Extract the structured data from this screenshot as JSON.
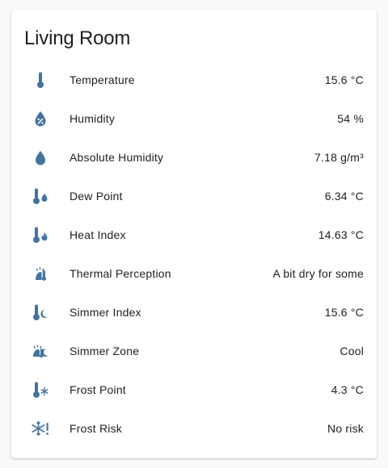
{
  "card": {
    "title": "Living Room",
    "icon_color": "#44739e",
    "rows": [
      {
        "icon": "thermometer-icon",
        "label": "Temperature",
        "value": "15.6 °C"
      },
      {
        "icon": "water-percent-icon",
        "label": "Humidity",
        "value": "54 %"
      },
      {
        "icon": "water-drop-icon",
        "label": "Absolute Humidity",
        "value": "7.18 g/m³"
      },
      {
        "icon": "thermometer-water-icon",
        "label": "Dew Point",
        "value": "6.34 °C"
      },
      {
        "icon": "thermometer-flame-icon",
        "label": "Heat Index",
        "value": "14.63 °C"
      },
      {
        "icon": "sun-thermometer-icon",
        "label": "Thermal Perception",
        "value": "A bit dry for some"
      },
      {
        "icon": "thermometer-moon-icon",
        "label": "Simmer Index",
        "value": "15.6 °C"
      },
      {
        "icon": "sun-moon-icon",
        "label": "Simmer Zone",
        "value": "Cool"
      },
      {
        "icon": "thermometer-snowflake-icon",
        "label": "Frost Point",
        "value": "4.3 °C"
      },
      {
        "icon": "snowflake-alert-icon",
        "label": "Frost Risk",
        "value": "No risk"
      }
    ]
  }
}
